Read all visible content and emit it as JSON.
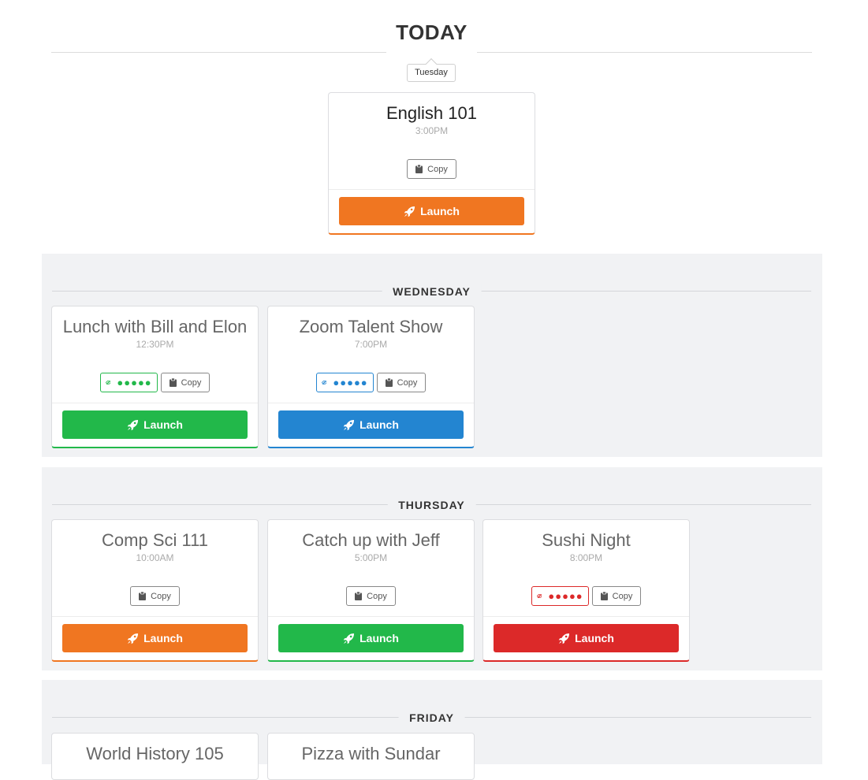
{
  "today": {
    "heading": "TODAY",
    "day_label": "Tuesday",
    "events": [
      {
        "title": "English 101",
        "time": "3:00PM",
        "copy_label": "Copy",
        "launch_label": "Launch",
        "color": "#f07621"
      }
    ]
  },
  "sections": [
    {
      "day": "WEDNESDAY",
      "events": [
        {
          "title": "Lunch with Bill and Elon",
          "time": "12:30PM",
          "password_mask": "●●●●●",
          "copy_label": "Copy",
          "launch_label": "Launch",
          "color": "#22b84a"
        },
        {
          "title": "Zoom Talent Show",
          "time": "7:00PM",
          "password_mask": "●●●●●",
          "copy_label": "Copy",
          "launch_label": "Launch",
          "color": "#2385d1"
        }
      ]
    },
    {
      "day": "THURSDAY",
      "events": [
        {
          "title": "Comp Sci 111",
          "time": "10:00AM",
          "copy_label": "Copy",
          "launch_label": "Launch",
          "color": "#f07621"
        },
        {
          "title": "Catch up with Jeff",
          "time": "5:00PM",
          "copy_label": "Copy",
          "launch_label": "Launch",
          "color": "#22b84a"
        },
        {
          "title": "Sushi Night",
          "time": "8:00PM",
          "password_mask": "●●●●●",
          "copy_label": "Copy",
          "launch_label": "Launch",
          "color": "#dc2929"
        }
      ]
    },
    {
      "day": "FRIDAY",
      "events": [
        {
          "title": "World History 105"
        },
        {
          "title": "Pizza with Sundar"
        }
      ]
    }
  ],
  "icons": {
    "launch": "rocket-icon",
    "copy": "clipboard-icon",
    "password": "eye-slash-icon"
  }
}
